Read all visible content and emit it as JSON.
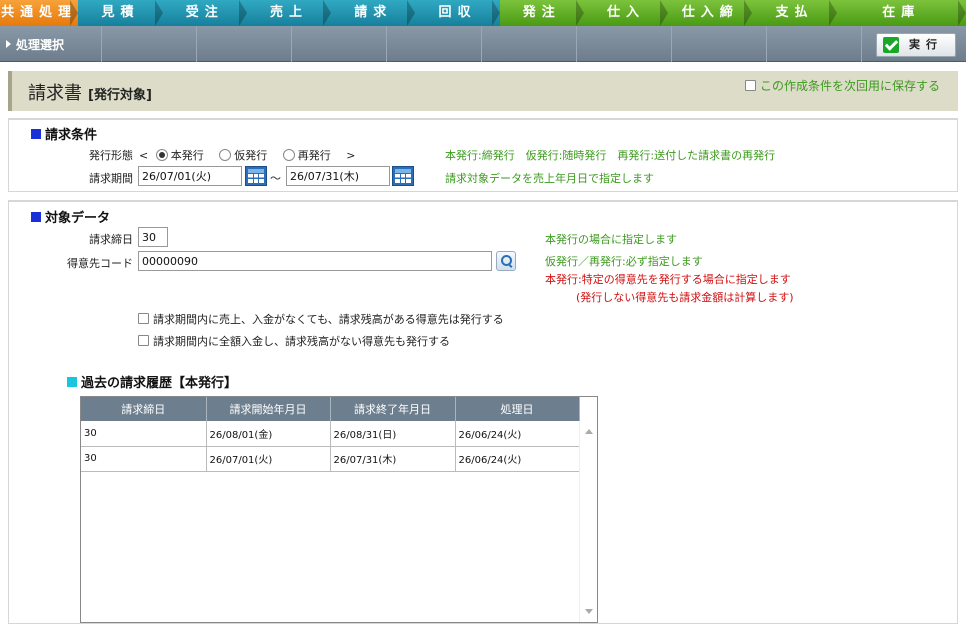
{
  "tabs": [
    {
      "label": "共通処理",
      "color": "orange",
      "w": 80
    },
    {
      "label": "見積",
      "color": "teal",
      "w": 86
    },
    {
      "label": "受注",
      "color": "teal",
      "w": 86
    },
    {
      "label": "売上",
      "color": "teal",
      "w": 86
    },
    {
      "label": "請求",
      "color": "teal",
      "w": 86
    },
    {
      "label": "回収",
      "color": "teal",
      "w": 86
    },
    {
      "label": "発注",
      "color": "green",
      "w": 86
    },
    {
      "label": "仕入",
      "color": "green",
      "w": 86
    },
    {
      "label": "仕入締",
      "color": "green",
      "w": 86
    },
    {
      "label": "支払",
      "color": "green",
      "w": 86
    },
    {
      "label": "在庫",
      "color": "green",
      "w": 132
    }
  ],
  "toolbar": {
    "process_select": "処理選択",
    "run_label": "実行"
  },
  "header": {
    "title": "請求書",
    "subtitle": "[発行対象]",
    "save_condition": "この作成条件を次回用に保存する"
  },
  "billing_conditions": {
    "heading": "請求条件",
    "issue_type_label": "発行形態",
    "bracket_open": "<",
    "bracket_close": ">",
    "options": [
      "本発行",
      "仮発行",
      "再発行"
    ],
    "selected": "本発行",
    "issue_type_note": "本発行:締発行　仮発行:随時発行　再発行:送付した請求書の再発行",
    "period_label": "請求期間",
    "period_from": "26/07/01(火)",
    "period_tilde": "～",
    "period_to": "26/07/31(木)",
    "period_note": "請求対象データを売上年月日で指定します"
  },
  "target_data": {
    "heading": "対象データ",
    "closing_day_label": "請求締日",
    "closing_day_value": "30",
    "closing_day_note": "本発行の場合に指定します",
    "customer_code_label": "得意先コード",
    "customer_code_value": "00000090",
    "customer_note_1": "仮発行／再発行:必ず指定します",
    "customer_note_2": "本発行:特定の得意先を発行する場合に指定します",
    "customer_note_3": "(発行しない得意先も請求金額は計算します)",
    "check_1": "請求期間内に売上、入金がなくても、請求残高がある得意先は発行する",
    "check_2": "請求期間内に全額入金し、請求残高がない得意先も発行する"
  },
  "history": {
    "heading": "過去の請求履歴【本発行】",
    "columns": [
      "請求締日",
      "請求開始年月日",
      "請求終了年月日",
      "処理日"
    ],
    "rows": [
      [
        "30",
        "26/08/01(金)",
        "26/08/31(日)",
        "26/06/24(火)"
      ],
      [
        "30",
        "26/07/01(火)",
        "26/07/31(木)",
        "26/06/24(火)"
      ]
    ]
  }
}
